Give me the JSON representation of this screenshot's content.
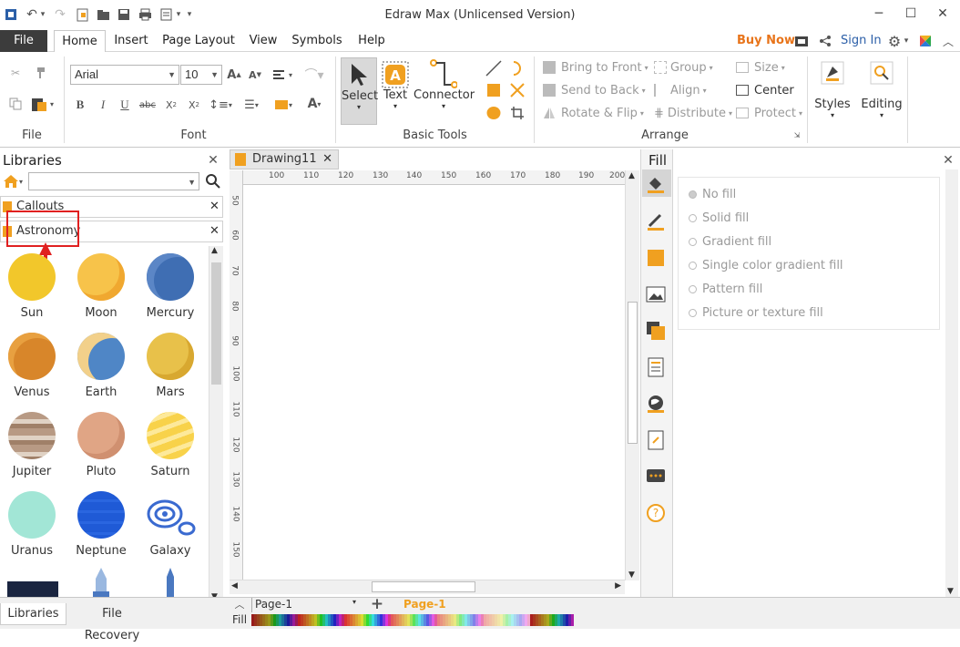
{
  "window": {
    "title": "Edraw Max (Unlicensed Version)"
  },
  "menu": {
    "file": "File",
    "tabs": [
      "Home",
      "Insert",
      "Page Layout",
      "View",
      "Symbols",
      "Help"
    ],
    "buy_now": "Buy Now",
    "sign_in": "Sign In"
  },
  "ribbon": {
    "font_name": "Arial",
    "font_size": "10",
    "groups": {
      "file": "File",
      "font": "Font",
      "basic_tools": "Basic Tools",
      "arrange": "Arrange"
    },
    "basic_tools": {
      "select": "Select",
      "text": "Text",
      "connector": "Connector"
    },
    "arrange": {
      "bring_to_front": "Bring to Front",
      "send_to_back": "Send to Back",
      "rotate_flip": "Rotate & Flip",
      "group": "Group",
      "align": "Align",
      "distribute": "Distribute",
      "size": "Size",
      "center": "Center",
      "protect": "Protect"
    },
    "styles": "Styles",
    "editing": "Editing"
  },
  "libraries": {
    "title": "Libraries",
    "categories": [
      "Callouts",
      "Astronomy"
    ],
    "shapes": [
      {
        "name": "Sun",
        "color": "#f2c72b"
      },
      {
        "name": "Moon",
        "color": "#f7c34a"
      },
      {
        "name": "Mercury",
        "color": "#3f6eb3"
      },
      {
        "name": "Venus",
        "color": "#d8862a"
      },
      {
        "name": "Earth",
        "color": "#4f86c6"
      },
      {
        "name": "Mars",
        "color": "#e8c14a"
      },
      {
        "name": "Jupiter",
        "color": "#b89a84"
      },
      {
        "name": "Pluto",
        "color": "#e0a585"
      },
      {
        "name": "Saturn",
        "color": "#f8d24a"
      },
      {
        "name": "Uranus",
        "color": "#a2e6d6"
      },
      {
        "name": "Neptune",
        "color": "#1f5ad6"
      },
      {
        "name": "Galaxy",
        "color": "#3a6ad0"
      }
    ],
    "bottom_tabs": [
      "Libraries",
      "File Recovery"
    ]
  },
  "document": {
    "tab": "Drawing11",
    "ruler_h": [
      "100",
      "110",
      "120",
      "130",
      "140",
      "150",
      "160",
      "170",
      "180",
      "190",
      "200"
    ],
    "ruler_v": [
      "50",
      "60",
      "70",
      "80",
      "90",
      "100",
      "110",
      "120",
      "130",
      "140",
      "150"
    ],
    "page_selector": "Page-1",
    "page_tab": "Page-1",
    "fill_label": "Fill"
  },
  "fill_panel": {
    "title": "Fill",
    "options": [
      "No fill",
      "Solid fill",
      "Gradient fill",
      "Single color gradient fill",
      "Pattern fill",
      "Picture or texture fill"
    ]
  },
  "colors": {
    "accent_orange": "#e8741a",
    "link_blue": "#2c5fa8",
    "highlight_red": "#e02020"
  }
}
